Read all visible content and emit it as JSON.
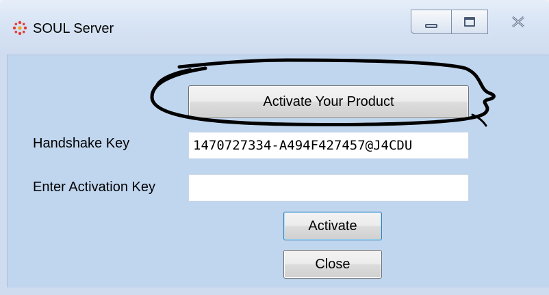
{
  "window": {
    "title": "SOUL Server",
    "icon": "soul-server-app-icon",
    "controls": [
      "minimize-icon",
      "maximize-icon",
      "close-icon"
    ]
  },
  "form": {
    "activate_product_label": "Activate Your Product",
    "handshake_label": "Handshake Key",
    "handshake_value": "1470727334-A494F427457@J4CDU",
    "activation_label": "Enter Activation Key",
    "activation_value": "",
    "activate_button": "Activate",
    "close_button": "Close"
  },
  "colors": {
    "client_background": "#c0d5ee",
    "annotation_stroke": "#000000",
    "app_icon_red": "#e53935"
  }
}
